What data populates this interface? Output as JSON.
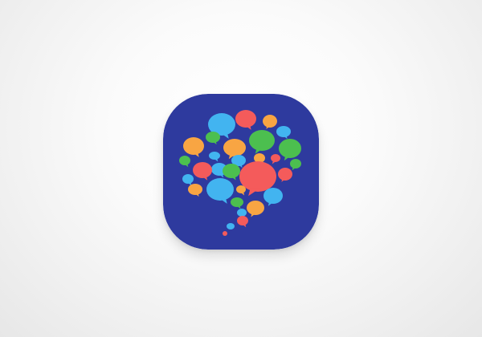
{
  "app_icon": {
    "icon_name": "chat-bubbles-cluster-icon",
    "background_color": "#2e3a9e",
    "bubble_colors": [
      "#42b4f0",
      "#f45b5b",
      "#4cbf4f",
      "#f8a543"
    ]
  }
}
